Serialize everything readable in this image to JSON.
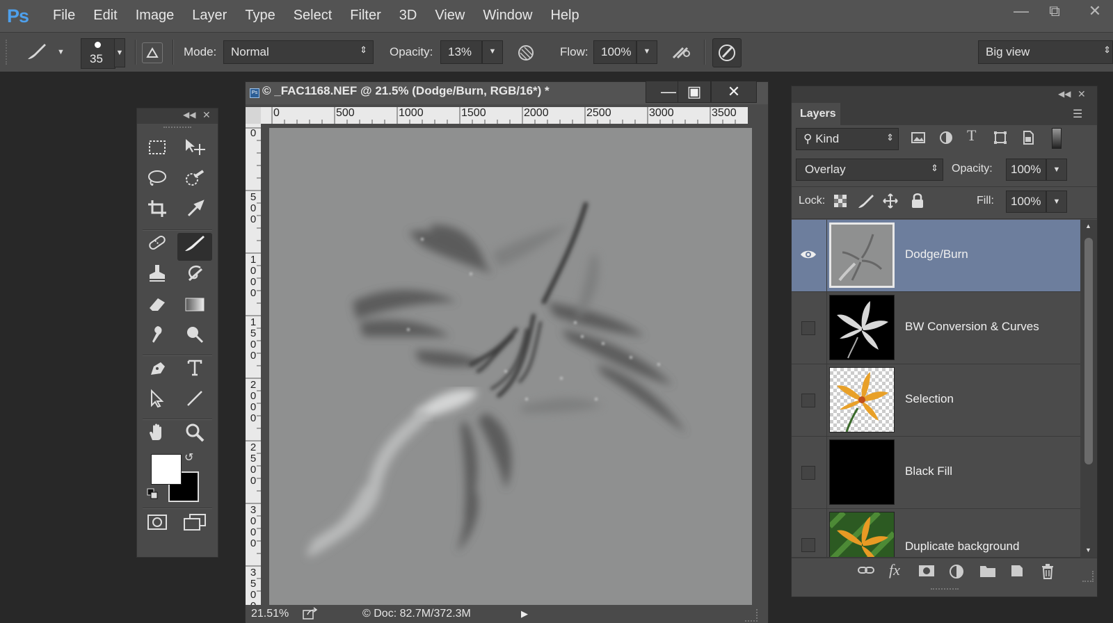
{
  "app": {
    "logo": "Ps"
  },
  "menus": [
    "File",
    "Edit",
    "Image",
    "Layer",
    "Type",
    "Select",
    "Filter",
    "3D",
    "View",
    "Window",
    "Help"
  ],
  "options_bar": {
    "brush_size": "35",
    "mode_label": "Mode:",
    "mode_value": "Normal",
    "opacity_label": "Opacity:",
    "opacity_value": "13%",
    "flow_label": "Flow:",
    "flow_value": "100%",
    "workspace": "Big view"
  },
  "document": {
    "title": "© _FAC1168.NEF @ 21.5% (Dodge/Burn, RGB/16*) *",
    "ruler_top": [
      "0",
      "500",
      "1000",
      "1500",
      "2000",
      "2500",
      "3000",
      "3500"
    ],
    "ruler_left": [
      "0",
      "500",
      "1000",
      "1500",
      "2000",
      "2500",
      "3000",
      "3500"
    ],
    "zoom": "21.51%",
    "doc_info": "© Doc: 82.7M/372.3M"
  },
  "layers_panel": {
    "tab": "Layers",
    "filter_kind": "Kind",
    "blend_mode": "Overlay",
    "opacity_label": "Opacity:",
    "opacity_value": "100%",
    "lock_label": "Lock:",
    "fill_label": "Fill:",
    "fill_value": "100%",
    "layers": [
      {
        "name": "Dodge/Burn",
        "visible": true,
        "selected": true
      },
      {
        "name": "BW Conversion & Curves",
        "visible": false,
        "selected": false
      },
      {
        "name": "Selection",
        "visible": false,
        "selected": false
      },
      {
        "name": "Black Fill",
        "visible": false,
        "selected": false
      },
      {
        "name": "Duplicate background",
        "visible": false,
        "selected": false
      }
    ]
  },
  "colors": {
    "foreground": "#ffffff",
    "background": "#000000",
    "selection_highlight": "#6d7e9d",
    "canvas_gray": "#8f9090",
    "ps_blue": "#4ea0ec"
  }
}
